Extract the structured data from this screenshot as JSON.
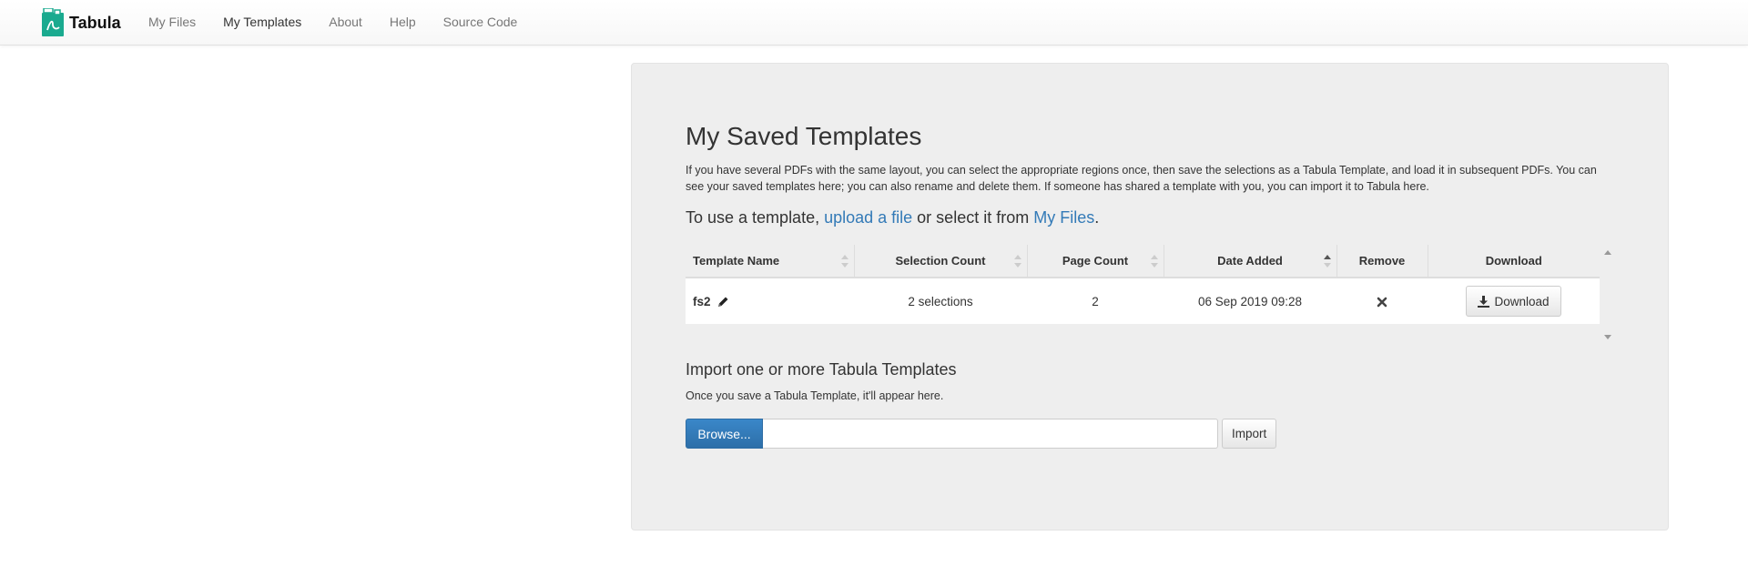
{
  "navbar": {
    "brand": "Tabula",
    "links": [
      "My Files",
      "My Templates",
      "About",
      "Help",
      "Source Code"
    ],
    "active": "My Templates"
  },
  "main": {
    "title": "My Saved Templates",
    "description": "If you have several PDFs with the same layout, you can select the appropriate regions once, then save the selections as a Tabula Template, and load it in subsequent PDFs. You can see your saved templates here; you can also rename and delete them. If someone has shared a template with you, you can import it to Tabula here.",
    "use_prefix": "To use a template, ",
    "upload_link": "upload a file",
    "use_middle": " or select it from ",
    "myfiles_link": "My Files",
    "use_suffix": "."
  },
  "table": {
    "headers": [
      "Template Name",
      "Selection Count",
      "Page Count",
      "Date Added",
      "Remove",
      "Download"
    ],
    "rows": [
      {
        "name": "fs2",
        "selection_count": "2 selections",
        "page_count": "2",
        "date_added": "06 Sep 2019 09:28",
        "download_label": "Download"
      }
    ]
  },
  "import": {
    "title": "Import one or more Tabula Templates",
    "help": "Once you save a Tabula Template, it'll appear here.",
    "browse_label": "Browse...",
    "file_value": "",
    "import_label": "Import"
  },
  "colors": {
    "accent": "#337ab7",
    "brand_icon": "#1aaa8f",
    "well_bg": "#eeeeee"
  }
}
